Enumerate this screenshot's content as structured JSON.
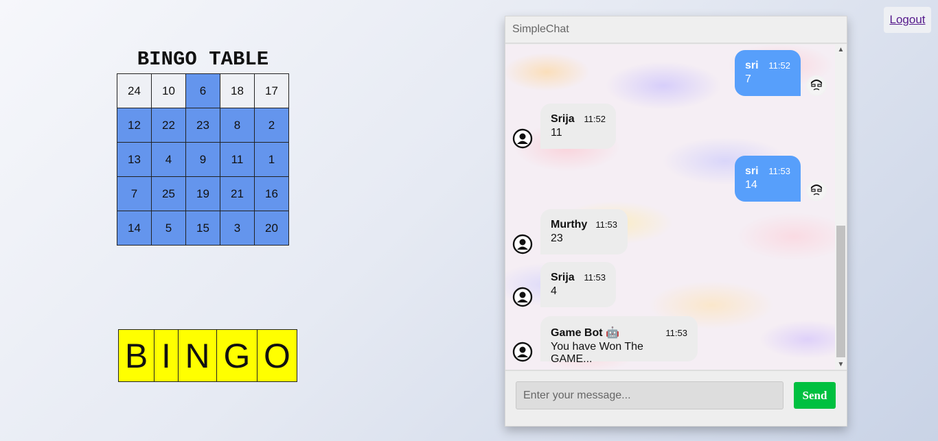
{
  "logout_label": "Logout",
  "bingo": {
    "title": "BINGO TABLE",
    "rows": [
      [
        {
          "n": "24",
          "marked": false
        },
        {
          "n": "10",
          "marked": false
        },
        {
          "n": "6",
          "marked": true
        },
        {
          "n": "18",
          "marked": false
        },
        {
          "n": "17",
          "marked": false
        }
      ],
      [
        {
          "n": "12",
          "marked": true
        },
        {
          "n": "22",
          "marked": true
        },
        {
          "n": "23",
          "marked": true
        },
        {
          "n": "8",
          "marked": true
        },
        {
          "n": "2",
          "marked": true
        }
      ],
      [
        {
          "n": "13",
          "marked": true
        },
        {
          "n": "4",
          "marked": true
        },
        {
          "n": "9",
          "marked": true
        },
        {
          "n": "11",
          "marked": true
        },
        {
          "n": "1",
          "marked": true
        }
      ],
      [
        {
          "n": "7",
          "marked": true
        },
        {
          "n": "25",
          "marked": true
        },
        {
          "n": "19",
          "marked": true
        },
        {
          "n": "21",
          "marked": true
        },
        {
          "n": "16",
          "marked": true
        }
      ],
      [
        {
          "n": "14",
          "marked": true
        },
        {
          "n": "5",
          "marked": true
        },
        {
          "n": "15",
          "marked": true
        },
        {
          "n": "3",
          "marked": true
        },
        {
          "n": "20",
          "marked": true
        }
      ]
    ],
    "marked_color": "#6495ed",
    "letters": [
      "B",
      "I",
      "N",
      "G",
      "O"
    ],
    "letters_color": "#ffff00"
  },
  "chat": {
    "title": "SimpleChat",
    "messages": [
      {
        "side": "right",
        "name": "sri",
        "time": "11:52",
        "text": "7",
        "avatar": "user-avatar-icon"
      },
      {
        "side": "left",
        "name": "Srija",
        "time": "11:52",
        "text": "11",
        "avatar": "default-avatar-icon"
      },
      {
        "side": "right",
        "name": "sri",
        "time": "11:53",
        "text": "14",
        "avatar": "user-avatar-icon"
      },
      {
        "side": "left",
        "name": "Murthy",
        "time": "11:53",
        "text": "23",
        "avatar": "default-avatar-icon"
      },
      {
        "side": "left",
        "name": "Srija",
        "time": "11:53",
        "text": "4",
        "avatar": "default-avatar-icon"
      },
      {
        "side": "left",
        "name": "Game Bot 🤖",
        "time": "11:53",
        "text": "You have Won The GAME...",
        "avatar": "default-avatar-icon"
      }
    ],
    "input_placeholder": "Enter your message...",
    "input_value": "",
    "send_label": "Send",
    "send_color": "#00c040",
    "own_bubble_color": "#579ffb"
  }
}
